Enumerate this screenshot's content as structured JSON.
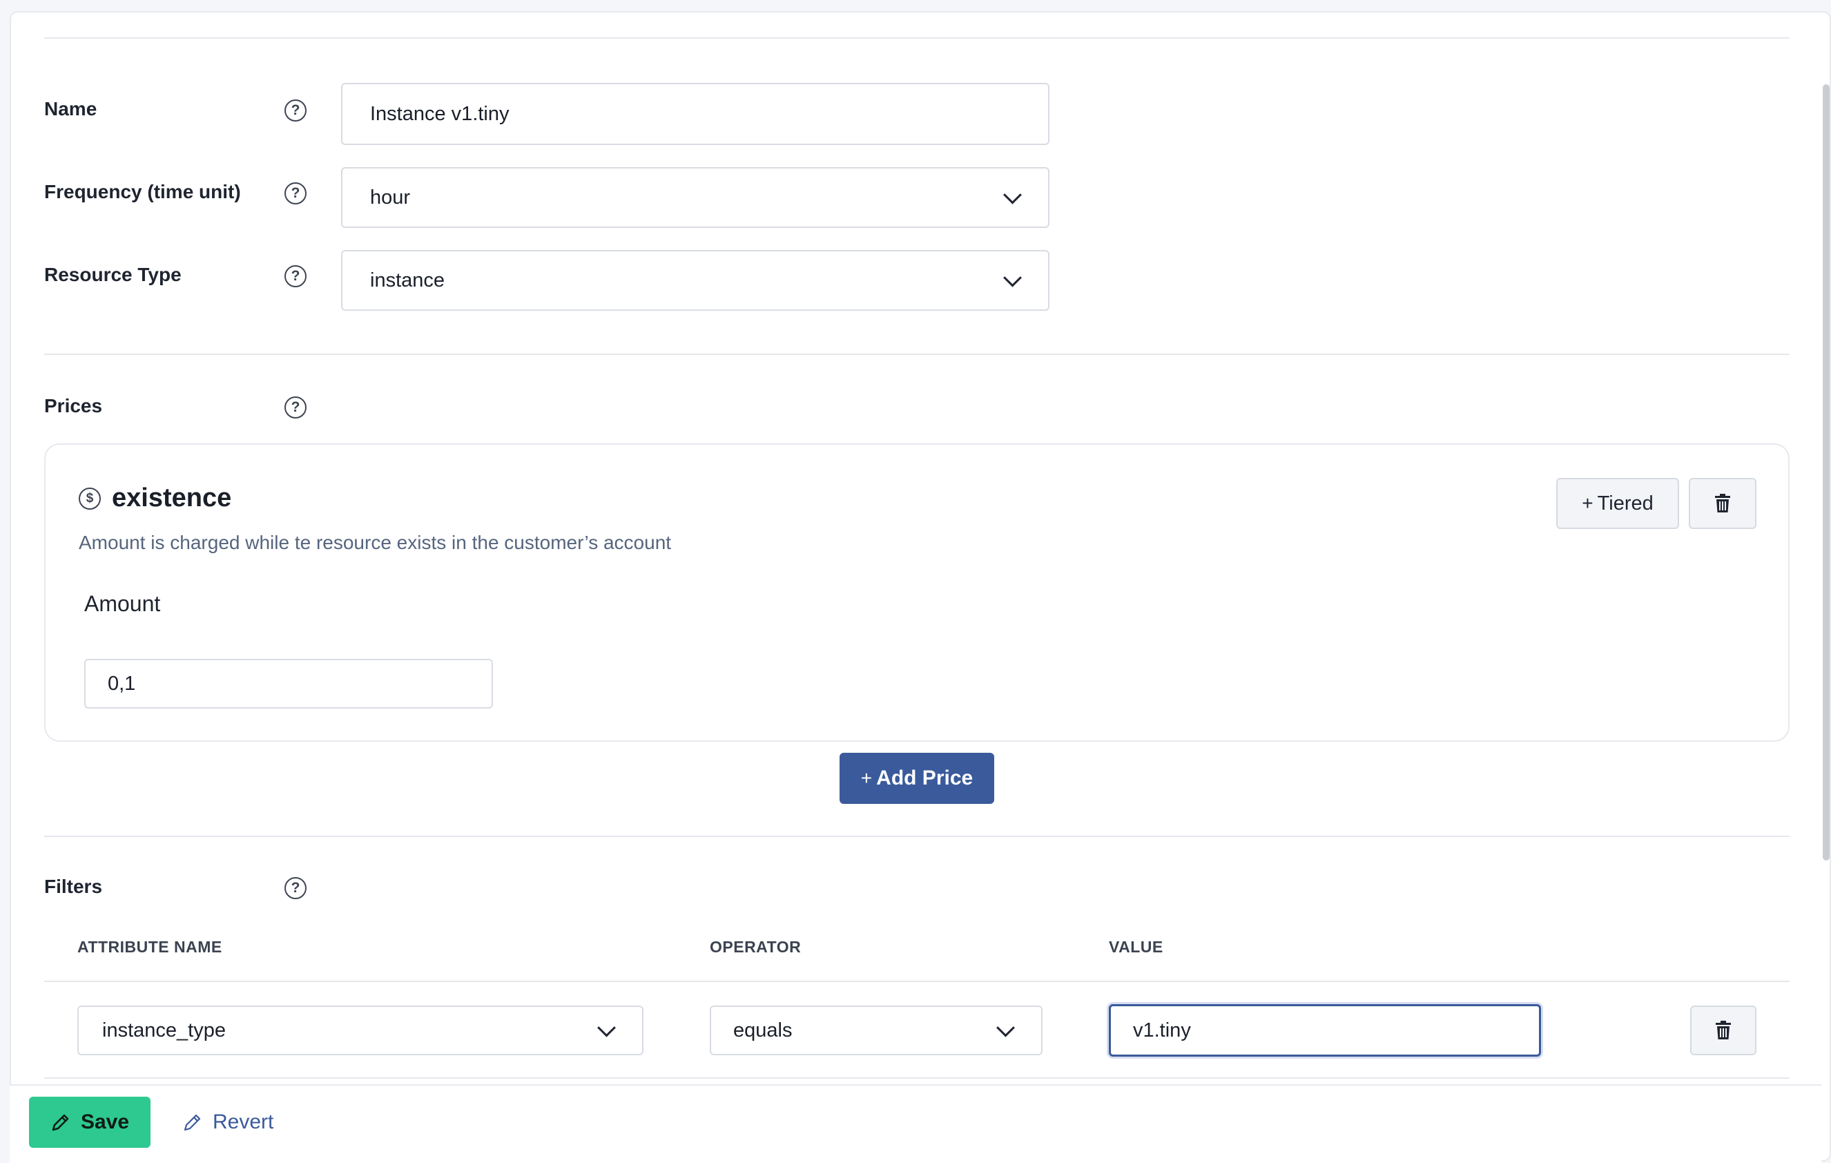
{
  "form": {
    "name": {
      "label": "Name",
      "value": "Instance v1.tiny"
    },
    "frequency": {
      "label": "Frequency (time unit)",
      "value": "hour"
    },
    "resource_type": {
      "label": "Resource Type",
      "value": "instance"
    }
  },
  "prices": {
    "label": "Prices",
    "items": [
      {
        "title": "existence",
        "description": "Amount is charged while te resource exists in the customer’s account",
        "amount_label": "Amount",
        "amount_value": "0,1",
        "tiered_label": "Tiered"
      }
    ],
    "add_label": "Add Price"
  },
  "filters": {
    "label": "Filters",
    "columns": [
      "ATTRIBUTE NAME",
      "OPERATOR",
      "VALUE"
    ],
    "rows": [
      {
        "attribute": "instance_type",
        "operator": "equals",
        "value": "v1.tiny"
      }
    ]
  },
  "footer": {
    "save_label": "Save",
    "revert_label": "Revert"
  },
  "icons": {
    "help": "question-circle-icon",
    "dollar": "dollar-circle-icon",
    "trash": "trash-icon",
    "pencil": "pencil-icon",
    "chevron": "chevron-down-icon"
  },
  "colors": {
    "primary": "#3a5a9b",
    "success": "#2ec990",
    "focus": "#3a5a9b"
  }
}
